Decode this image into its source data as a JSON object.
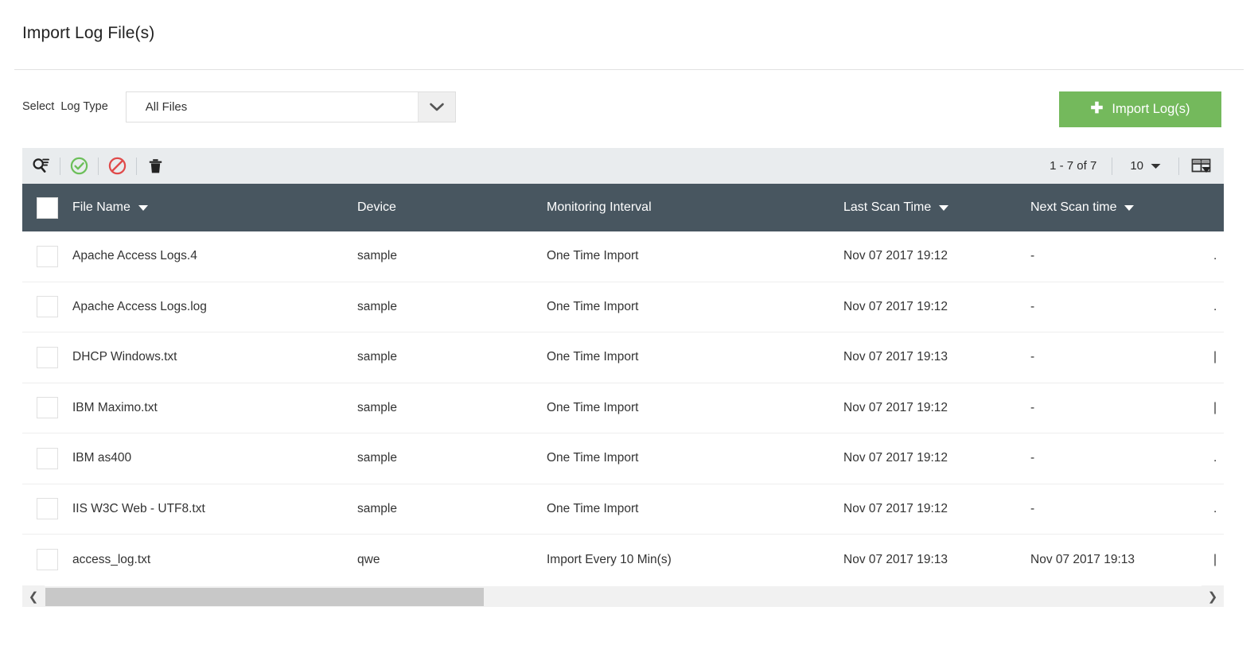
{
  "page": {
    "title": "Import Log File(s)"
  },
  "filter": {
    "label": "Select  Log Type",
    "selected_value": "All Files",
    "chevron_icon": "chevron-down-icon"
  },
  "actions": {
    "import_button_label": "Import Log(s)",
    "import_button_icon": "plus-icon",
    "import_button_color": "#74b95c"
  },
  "toolbar": {
    "icons": [
      {
        "name": "scan-search-icon",
        "title": "Scan"
      },
      {
        "name": "approve-check-icon",
        "title": "Enable",
        "color": "#66bb55"
      },
      {
        "name": "block-prohibited-icon",
        "title": "Disable",
        "color": "#e24b4b"
      },
      {
        "name": "delete-trash-icon",
        "title": "Delete",
        "color": "#333333"
      }
    ],
    "record_range": "1 - 7 of 7",
    "page_size": "10",
    "page_size_caret_icon": "caret-down-icon",
    "column_chooser_icon": "column-chooser-icon"
  },
  "table": {
    "header_bg": "#485660",
    "select_all_checkbox": false,
    "columns": [
      {
        "label": "File Name",
        "sortable": true
      },
      {
        "label": "Device",
        "sortable": false
      },
      {
        "label": "Monitoring Interval",
        "sortable": false
      },
      {
        "label": "Last Scan Time",
        "sortable": true
      },
      {
        "label": "Next Scan time",
        "sortable": true
      }
    ],
    "rows": [
      {
        "checked": false,
        "file_name": "Apache Access Logs.4",
        "device": "sample",
        "monitoring_interval": "One Time Import",
        "last_scan_time": "Nov 07 2017 19:12",
        "next_scan_time": "-",
        "overflow": "."
      },
      {
        "checked": false,
        "file_name": "Apache Access Logs.log",
        "device": "sample",
        "monitoring_interval": "One Time Import",
        "last_scan_time": "Nov 07 2017 19:12",
        "next_scan_time": "-",
        "overflow": "."
      },
      {
        "checked": false,
        "file_name": "DHCP Windows.txt",
        "device": "sample",
        "monitoring_interval": "One Time Import",
        "last_scan_time": "Nov 07 2017 19:13",
        "next_scan_time": "-",
        "overflow": "|"
      },
      {
        "checked": false,
        "file_name": "IBM Maximo.txt",
        "device": "sample",
        "monitoring_interval": "One Time Import",
        "last_scan_time": "Nov 07 2017 19:12",
        "next_scan_time": "-",
        "overflow": "|"
      },
      {
        "checked": false,
        "file_name": "IBM as400",
        "device": "sample",
        "monitoring_interval": "One Time Import",
        "last_scan_time": "Nov 07 2017 19:12",
        "next_scan_time": "-",
        "overflow": "."
      },
      {
        "checked": false,
        "file_name": "IIS W3C Web - UTF8.txt",
        "device": "sample",
        "monitoring_interval": "One Time Import",
        "last_scan_time": "Nov 07 2017 19:12",
        "next_scan_time": "-",
        "overflow": "."
      },
      {
        "checked": false,
        "file_name": "access_log.txt",
        "device": "qwe",
        "monitoring_interval": "Import Every 10 Min(s)",
        "last_scan_time": "Nov 07 2017 19:13",
        "next_scan_time": "Nov 07 2017 19:13",
        "overflow": "|"
      }
    ]
  },
  "scrollbar": {
    "left_arrow_icon": "chevron-left-icon",
    "right_arrow_icon": "chevron-right-icon"
  }
}
